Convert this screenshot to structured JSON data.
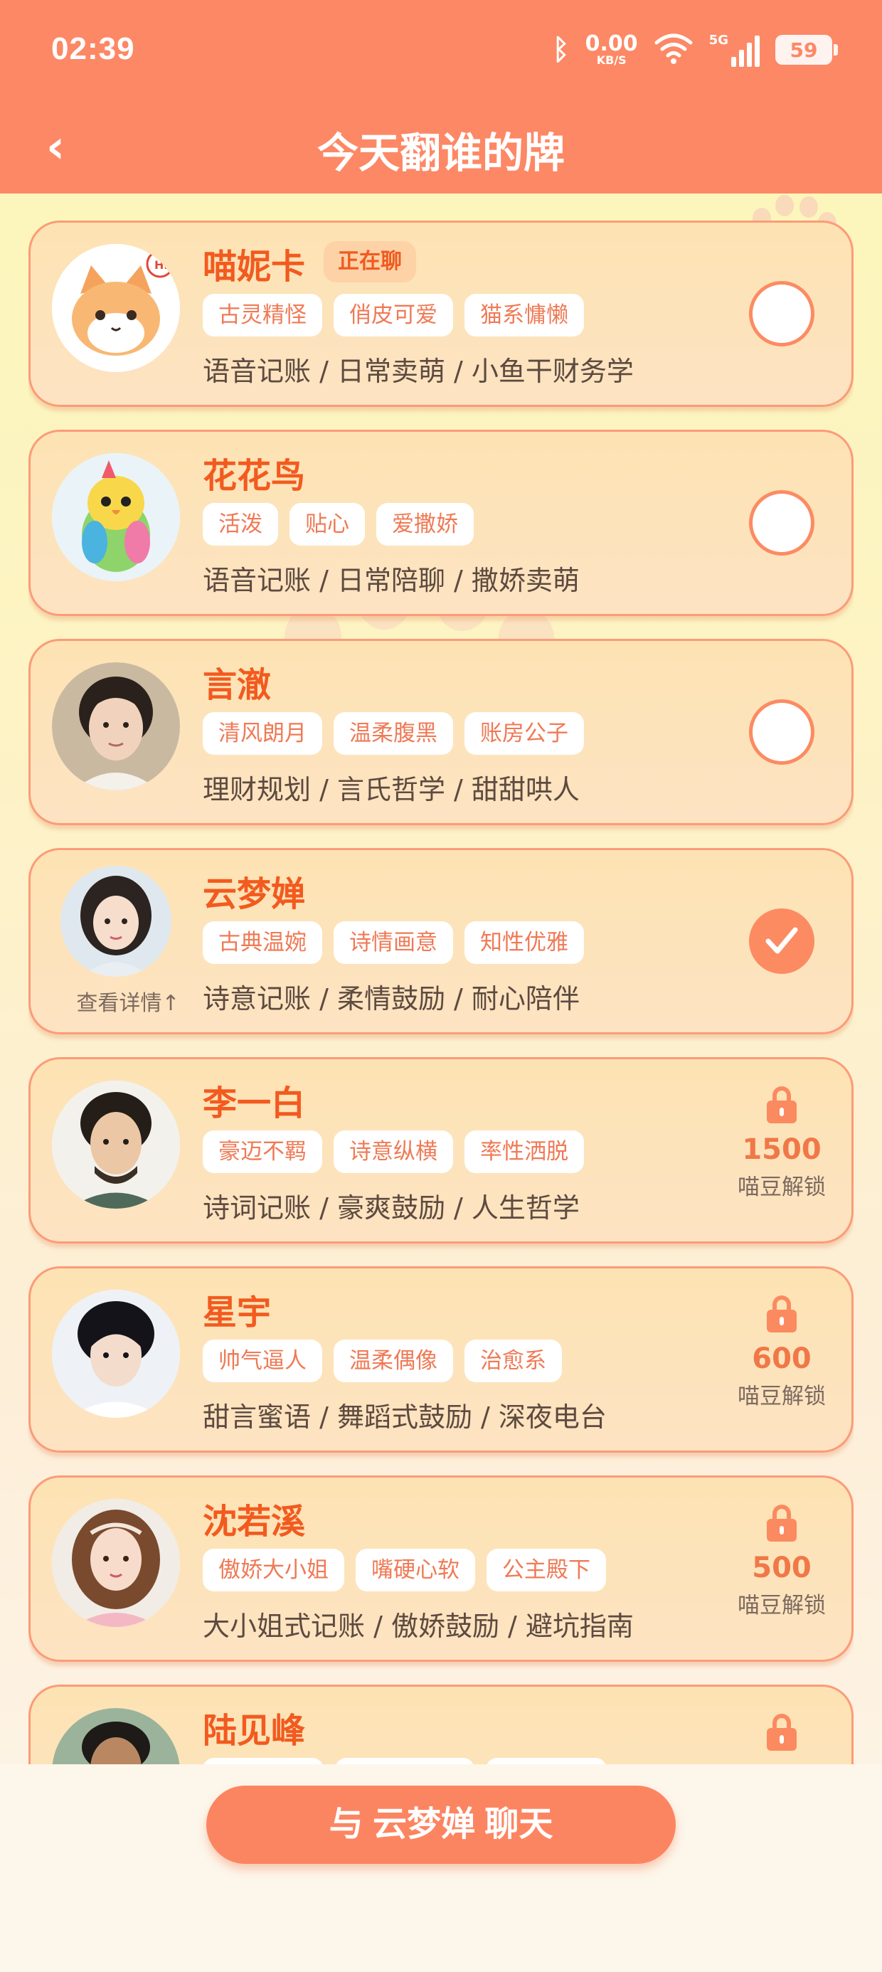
{
  "status_bar": {
    "time": "02:39",
    "net_speed_value": "0.00",
    "net_speed_unit": "KB/S",
    "network_label": "5G",
    "battery": "59"
  },
  "header": {
    "back_glyph": "‹",
    "title": "今天翻谁的牌"
  },
  "colors": {
    "accent": "#fd8865",
    "name": "#f25a1f",
    "card_bg": "#fde3b3"
  },
  "characters": [
    {
      "name": "喵妮卡",
      "badge": "正在聊",
      "tags": [
        "古灵精怪",
        "俏皮可爱",
        "猫系慵懒"
      ],
      "desc": "语音记账 / 日常卖萌 / 小鱼干财务学",
      "state": "unchecked",
      "avatar_icon": "cat-avatar"
    },
    {
      "name": "花花鸟",
      "tags": [
        "活泼",
        "贴心",
        "爱撒娇"
      ],
      "desc": "语音记账 / 日常陪聊 / 撒娇卖萌",
      "state": "unchecked",
      "avatar_icon": "parrot-avatar"
    },
    {
      "name": "言澈",
      "tags": [
        "清风朗月",
        "温柔腹黑",
        "账房公子"
      ],
      "desc": "理财规划 / 言氏哲学 / 甜甜哄人",
      "state": "unchecked",
      "avatar_icon": "man-avatar"
    },
    {
      "name": "云梦婵",
      "tags": [
        "古典温婉",
        "诗情画意",
        "知性优雅"
      ],
      "desc": "诗意记账 / 柔情鼓励 / 耐心陪伴",
      "state": "checked",
      "detail_link": "查看详情↑",
      "avatar_icon": "woman-avatar"
    },
    {
      "name": "李一白",
      "tags": [
        "豪迈不羁",
        "诗意纵横",
        "率性洒脱"
      ],
      "desc": "诗词记账 / 豪爽鼓励 / 人生哲学",
      "state": "locked",
      "price": "1500",
      "unlock_label": "喵豆解锁",
      "avatar_icon": "man-avatar"
    },
    {
      "name": "星宇",
      "tags": [
        "帅气逼人",
        "温柔偶像",
        "治愈系"
      ],
      "desc": "甜言蜜语 / 舞蹈式鼓励 / 深夜电台",
      "state": "locked",
      "price": "600",
      "unlock_label": "喵豆解锁",
      "avatar_icon": "man-avatar"
    },
    {
      "name": "沈若溪",
      "tags": [
        "傲娇大小姐",
        "嘴硬心软",
        "公主殿下"
      ],
      "desc": "大小姐式记账 / 傲娇鼓励 / 避坑指南",
      "state": "locked",
      "price": "500",
      "unlock_label": "喵豆解锁",
      "avatar_icon": "woman-avatar"
    },
    {
      "name": "陆见峰",
      "tags": [
        "",
        "",
        ""
      ],
      "desc": "",
      "state": "locked",
      "avatar_icon": "man-avatar"
    }
  ],
  "footer": {
    "chat_button": "与 云梦婵 聊天"
  }
}
